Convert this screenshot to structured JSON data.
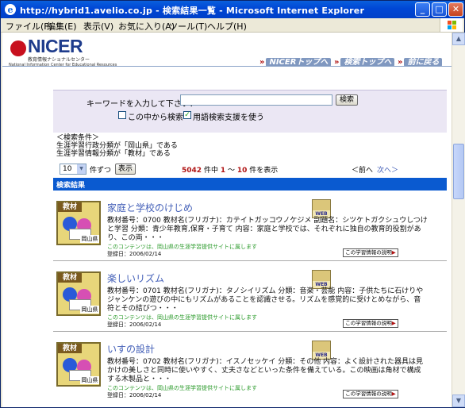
{
  "window": {
    "title": "http://hybrid1.avelio.co.jp - 検索結果一覧 - Microsoft Internet Explorer",
    "buttons": {
      "min": "_",
      "max": "□",
      "close": "✕"
    }
  },
  "menu": {
    "items": [
      "ファイル(F)",
      "編集(E)",
      "表示(V)",
      "お気に入り(A)",
      "ツール(T)",
      "ヘルプ(H)"
    ]
  },
  "header": {
    "logo_text": "NICER",
    "logo_sub": "教育情報ナショナルセンター",
    "logo_sub2": "National Information Center for Educational Resources",
    "nav": [
      "NICERトップへ",
      "検索トップへ",
      "前に戻る"
    ]
  },
  "search": {
    "prompt": "キーワードを入力して下さい：",
    "keyword_value": "",
    "search_button": "検索",
    "within_label": "この中から検索",
    "within_checked": false,
    "thesaurus_label": "用語検索支援を使う",
    "thesaurus_checked": true
  },
  "conditions": {
    "heading": "＜検索条件＞",
    "lines": [
      "生涯学習行政分類が「岡山県」である",
      "生涯学習情報分類が「教材」である"
    ]
  },
  "pager": {
    "per_page": "10",
    "per_page_suffix": "件ずつ",
    "display_button": "表示",
    "total": "5042",
    "middle": "件中",
    "from": "1",
    "to": "10",
    "tail": "件を表示",
    "prev": "＜前へ",
    "next": "次へ＞"
  },
  "results_header": "検索結果",
  "results": [
    {
      "tag": "教材",
      "pref": "岡山県",
      "title": "家庭と学校のけじめ",
      "desc": "教材番号：0700 教材名(フリガナ)：カテイトガッコウノケジメ 副題名：シツケトガクシュウしつけと学習 分類：青少年教育,保育・子育て 内容：家庭と学校では、それぞれに独自の教育的役割があり、この両・・・",
      "note": "このコンテンツは、岡山県の生涯学習提供サイトに属します",
      "date": "登録日：2006/02/14",
      "info_label": "この学習情報の説明"
    },
    {
      "tag": "教材",
      "pref": "岡山県",
      "title": "楽しいリズム",
      "desc": "教材番号：0701 教材名(フリガナ)：タノシイリズム 分類：音楽・芸能 内容：子供たちに石けりやジャンケンの遊びの中にもリズムがあることを認識させる。リズムを感覚的に受けとめながら、音符とその結びつ・・・",
      "note": "このコンテンツは、岡山県の生涯学習提供サイトに属します",
      "date": "登録日：2006/02/14",
      "info_label": "この学習情報の説明"
    },
    {
      "tag": "教材",
      "pref": "岡山県",
      "title": "いすの設計",
      "desc": "教材番号：0702 教材名(フリガナ)：イスノセッケイ 分類：その他 内容：よく設計された器具は見かけの美しさと同時に使いやすく、丈夫さなどといった条件を備えている。この映画は角材で構成する木製品と・・・",
      "note": "このコンテンツは、岡山県の生涯学習提供サイトに属します",
      "date": "登録日：2006/02/14",
      "info_label": "この学習情報の説明"
    }
  ]
}
